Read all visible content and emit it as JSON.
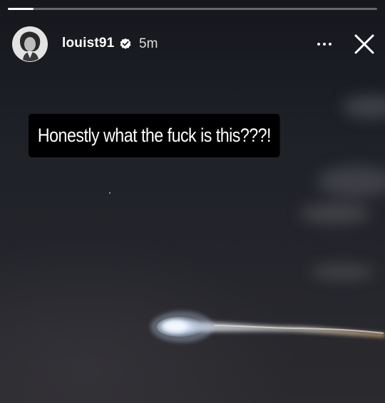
{
  "story": {
    "progress": 0.07,
    "username": "louist91",
    "verified": true,
    "time_ago": "5m",
    "caption": "Honestly what the fuck is this???!"
  },
  "icons": {
    "verified": "verified-badge-icon",
    "more": "more-options-icon",
    "close": "close-icon"
  },
  "colors": {
    "caption_background": "#000000",
    "text": "#ffffff",
    "progress_track": "#8e8f93",
    "sky": "#1f2128"
  }
}
